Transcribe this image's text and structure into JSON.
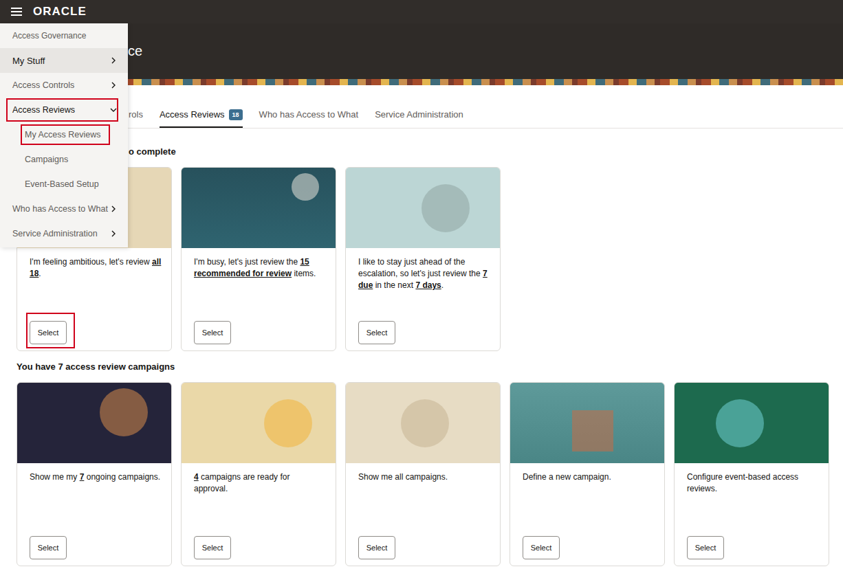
{
  "topbar": {
    "logo": "ORACLE"
  },
  "header": {
    "title": "ce"
  },
  "tabs": [
    {
      "label": "rols",
      "selected": false
    },
    {
      "label": "Access Reviews",
      "selected": true,
      "badge": "18"
    },
    {
      "label": "Who has Access to What",
      "selected": false
    },
    {
      "label": "Service Administration",
      "selected": false
    }
  ],
  "menu": {
    "items": [
      {
        "label": "Access Governance",
        "kind": "title",
        "active": false,
        "annotated": false
      },
      {
        "label": "My Stuff",
        "kind": "group",
        "expanded": false,
        "active": true,
        "annotated": false
      },
      {
        "label": "Access Controls",
        "kind": "group",
        "expanded": false,
        "active": false,
        "annotated": false
      },
      {
        "label": "Access Reviews",
        "kind": "group",
        "expanded": true,
        "active": false,
        "annotated": true
      },
      {
        "label": "My Access Reviews",
        "kind": "subitem",
        "active": false,
        "annotated": true
      },
      {
        "label": "Campaigns",
        "kind": "subitem",
        "active": false,
        "annotated": false
      },
      {
        "label": "Event-Based Setup",
        "kind": "subitem",
        "active": false,
        "annotated": false
      },
      {
        "label": "Who has Access to What",
        "kind": "group",
        "expanded": false,
        "active": false,
        "annotated": false
      },
      {
        "label": "Service Administration",
        "kind": "group",
        "expanded": false,
        "active": false,
        "annotated": false
      }
    ]
  },
  "reviews": {
    "heading": "o complete",
    "cards": [
      {
        "segments": [
          {
            "text": "I'm feeling ambitious, let's review ",
            "link": false
          },
          {
            "text": "all 18",
            "link": true
          },
          {
            "text": ".",
            "link": false
          }
        ],
        "button": "Select",
        "annotated": true
      },
      {
        "segments": [
          {
            "text": "I'm busy, let's just review the ",
            "link": false
          },
          {
            "text": "15 recommended for review",
            "link": true
          },
          {
            "text": " items.",
            "link": false
          }
        ],
        "button": "Select",
        "annotated": false
      },
      {
        "segments": [
          {
            "text": "I like to stay just ahead of the escalation, so let's just review the ",
            "link": false
          },
          {
            "text": "7 due",
            "link": true
          },
          {
            "text": " in the next ",
            "link": false
          },
          {
            "text": "7 days",
            "link": true
          },
          {
            "text": ".",
            "link": false
          }
        ],
        "button": "Select",
        "annotated": false
      }
    ]
  },
  "campaigns": {
    "heading": "You have 7 access review campaigns",
    "cards": [
      {
        "segments": [
          {
            "text": "Show me my ",
            "link": false
          },
          {
            "text": "7",
            "link": true
          },
          {
            "text": " ongoing campaigns.",
            "link": false
          }
        ],
        "button": "Select",
        "annotated": false
      },
      {
        "segments": [
          {
            "text": "4",
            "link": true
          },
          {
            "text": " campaigns are ready for approval.",
            "link": false
          }
        ],
        "button": "Select",
        "annotated": false
      },
      {
        "segments": [
          {
            "text": "Show me all campaigns.",
            "link": false
          }
        ],
        "button": "Select",
        "annotated": false
      },
      {
        "segments": [
          {
            "text": "Define a new campaign.",
            "link": false
          }
        ],
        "button": "Select",
        "annotated": false
      },
      {
        "segments": [
          {
            "text": "Configure event-based access reviews.",
            "link": false
          }
        ],
        "button": "Select",
        "annotated": false
      }
    ]
  }
}
